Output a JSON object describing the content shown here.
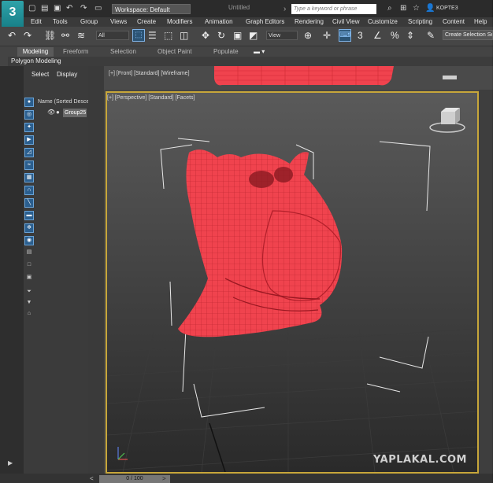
{
  "app": {
    "logo_text": "3",
    "workspace": "Workspace: Default",
    "title": "Untitled",
    "search_placeholder": "Type a keyword or phrase",
    "user": "KOPTE3"
  },
  "menu": [
    "Edit",
    "Tools",
    "Group",
    "Views",
    "Create",
    "Modifiers",
    "Animation",
    "Graph Editors",
    "Rendering",
    "Civil View",
    "Customize",
    "Scripting",
    "Content",
    "Help"
  ],
  "toolbar": {
    "selection_filter": "All",
    "ref_coord": "View",
    "create_selection_set": "Create Selection Se"
  },
  "ribbon": {
    "tabs": [
      "Modeling",
      "Freeform",
      "Selection",
      "Object Paint",
      "Populate"
    ],
    "panel_label": "Polygon Modeling"
  },
  "scene_explorer": {
    "tabs": [
      "Select",
      "Display"
    ],
    "column_header": "Name (Sorted Desce",
    "item": "Group25"
  },
  "viewports": {
    "front_label": "[+] [Front] [Standard] [Wireframe]",
    "persp_label": "[+] [Perspective] [Standard] [Facets]"
  },
  "timeline": {
    "frame": "0 / 100"
  },
  "watermark": "YAPLAKAL.COM",
  "colors": {
    "mesh": "#f0434e",
    "active_border": "#c7a63a",
    "selected_icon": "#2b5f8f"
  }
}
